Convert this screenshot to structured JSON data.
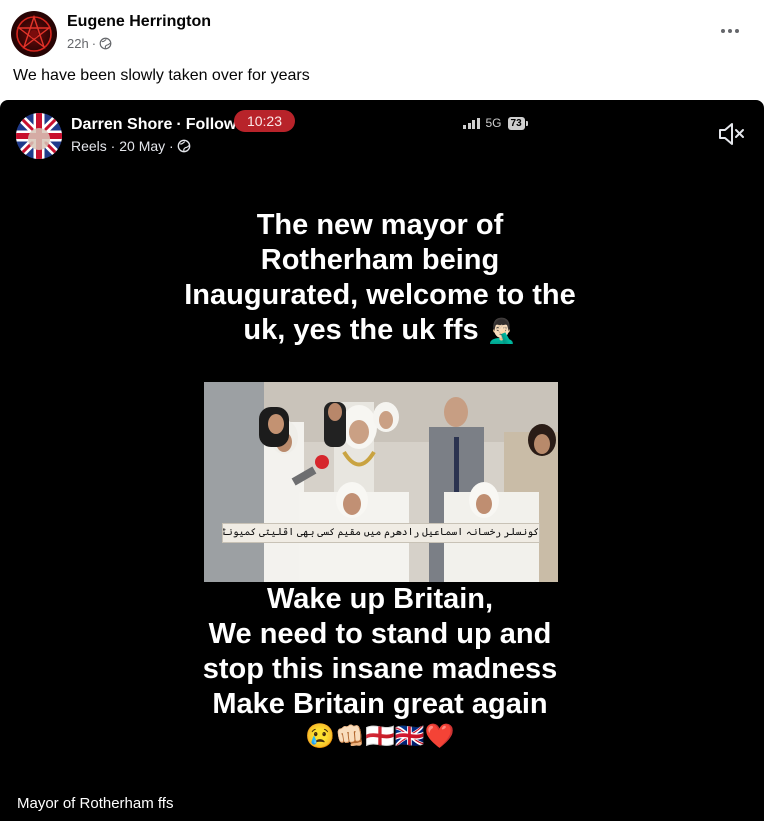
{
  "post": {
    "author": "Eugene Herrington",
    "time": "22h",
    "audience_icon": "globe-icon",
    "text": "We have been slowly taken over for years",
    "more_icon": "more-horizontal-icon"
  },
  "video": {
    "author": "Darren Shore",
    "separator": "·",
    "follow": "Follow",
    "meta": "Reels · 20 May ·",
    "meta_icon": "globe-icon",
    "time_pill": "10:23",
    "network": "5G",
    "battery": "73",
    "mute_icon": "speaker-muted-icon",
    "caption_top": "The new mayor of Rotherham being Inaugurated, welcome to the uk, yes the uk ffs",
    "caption_top_emoji": "🤦🏻‍♂️",
    "urdu_banner": "کونسلر رخسانہ اسماعیل رادھرم میں مقیم کسی بھی اقلیتی کمیونٹی سے تعلق رکھنے والی پہلی خاتون میئر منتخب ہو گئی ہیں",
    "caption_bottom_lines": [
      "Wake up Britain,",
      "We need to stand up and",
      "stop this insane madness",
      "Make Britain great again"
    ],
    "caption_emojis": "😢👊🏻🏴󠁧󠁢󠁥󠁮󠁧󠁿🇬🇧❤️",
    "footer": "Mayor of Rotherham ffs"
  },
  "colors": {
    "brand_text": "#050505",
    "secondary_text": "#65676b",
    "pill_red": "#b8232a",
    "video_bg": "#000000"
  }
}
